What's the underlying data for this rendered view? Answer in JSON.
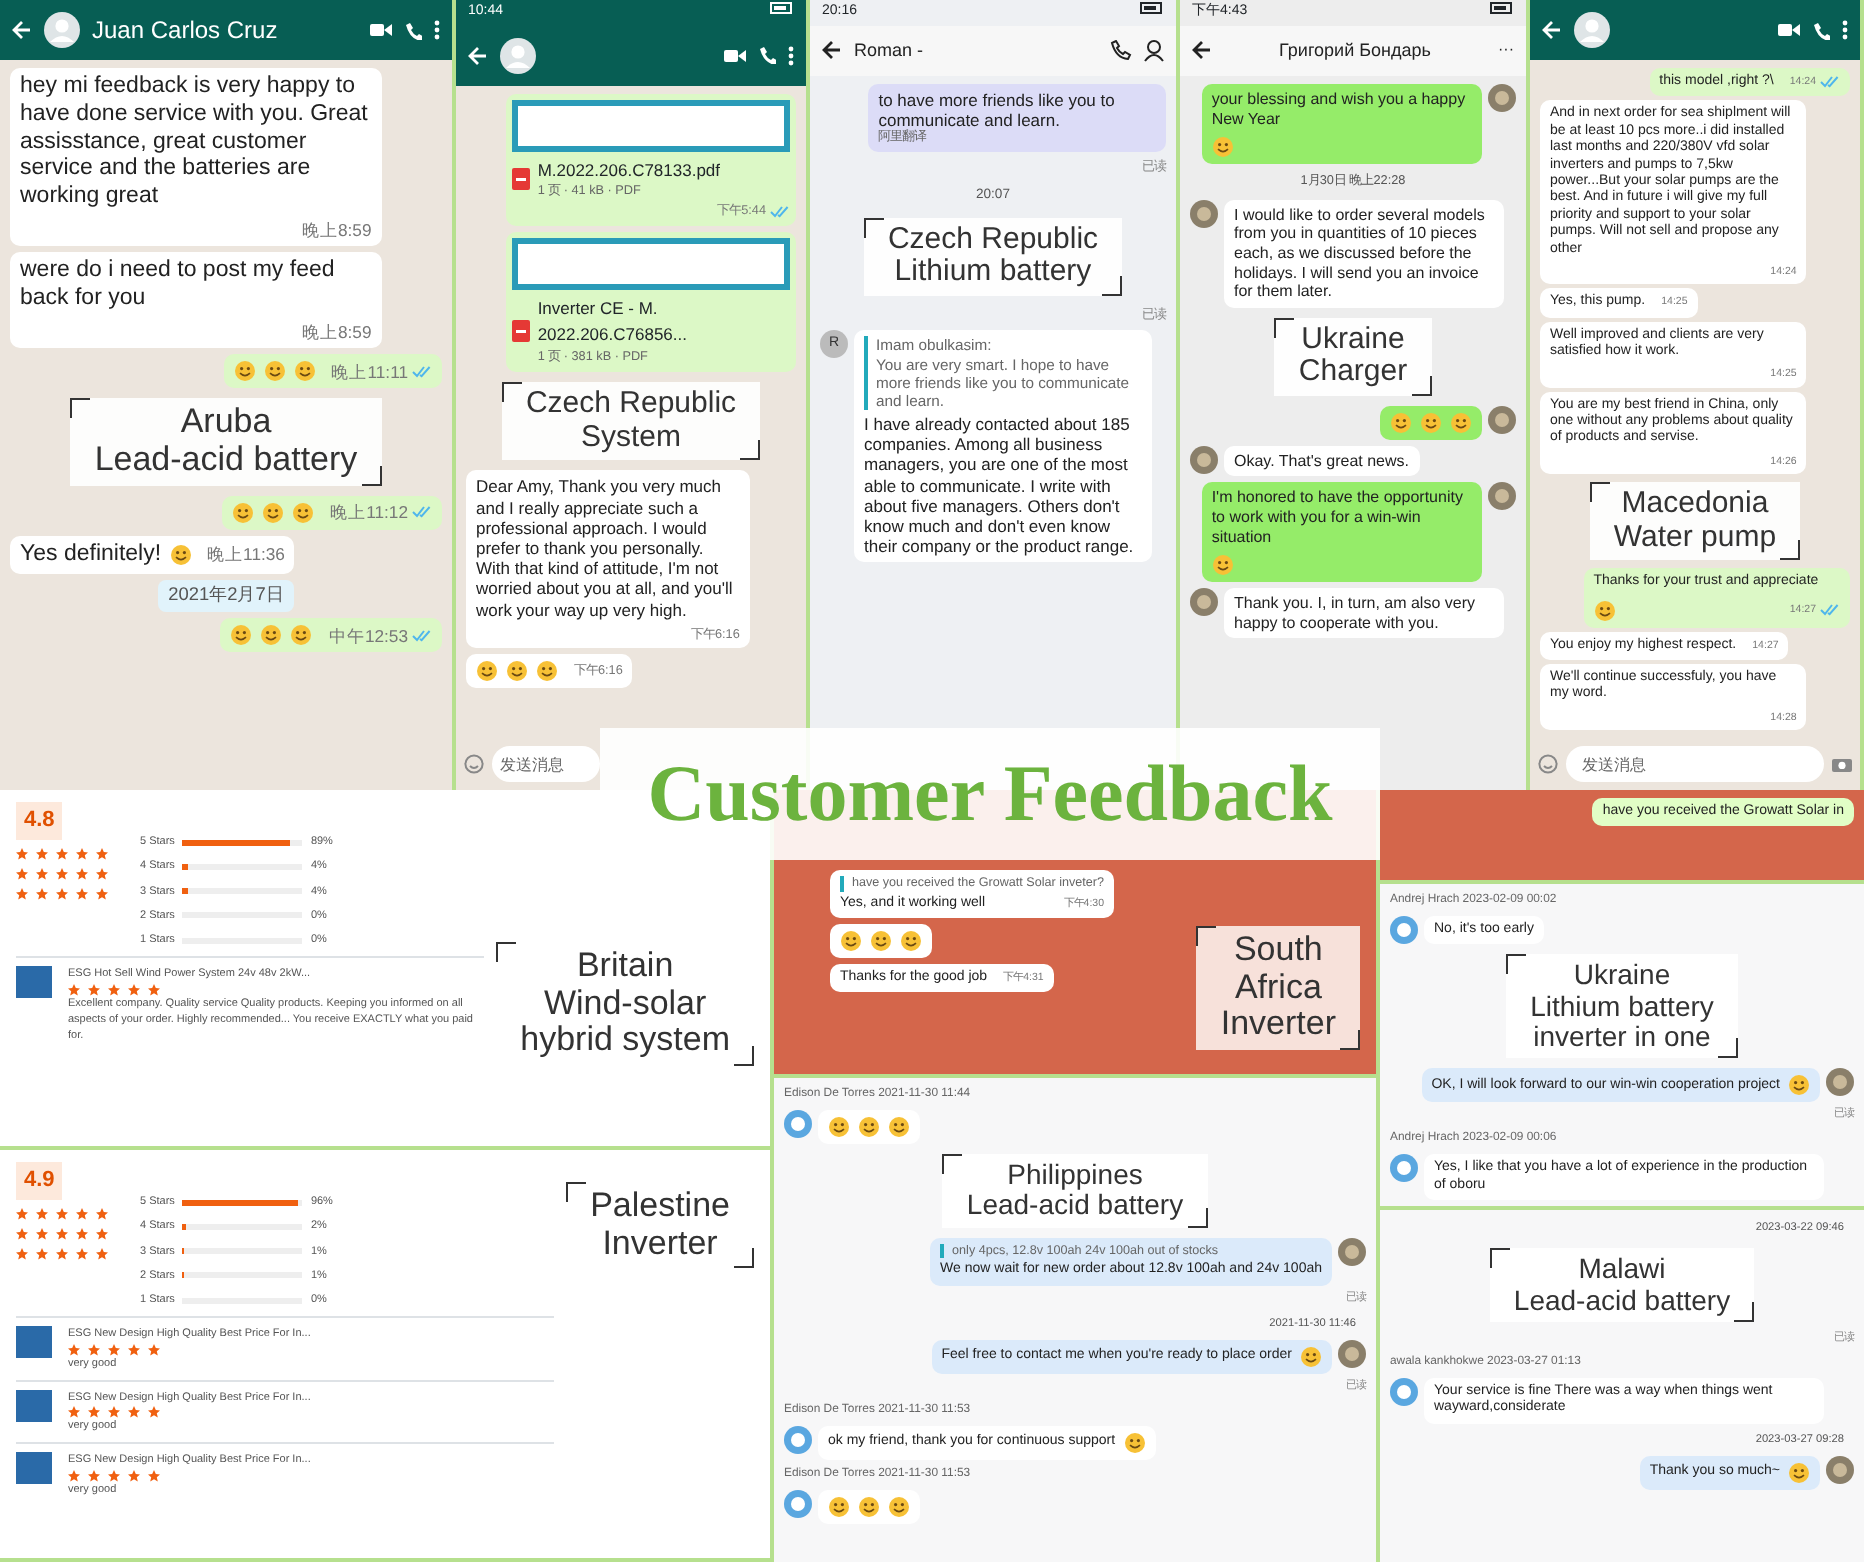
{
  "title": "Customer Feedback",
  "top_panels": [
    {
      "kind": "whatsapp",
      "header": {
        "title": "Juan Carlos Cruz"
      },
      "messages": [
        {
          "kind": "msg",
          "outgoing": false,
          "text": "hey mi feedback is very  happy to have done service  with you. Great assisstance, great customer service and the batteries are working great",
          "time": "晚上8:59"
        },
        {
          "kind": "msg",
          "outgoing": false,
          "text": "were do i need to post my feed back for you",
          "time": "晚上8:59"
        },
        {
          "kind": "msg",
          "outgoing": true,
          "emoji": true,
          "time": "晚上11:11",
          "read": true
        },
        {
          "kind": "label",
          "lines": [
            "Aruba",
            "Lead-acid battery"
          ]
        },
        {
          "kind": "msg",
          "outgoing": true,
          "emoji": true,
          "time": "晚上11:12",
          "read": true
        },
        {
          "kind": "msg",
          "outgoing": false,
          "text": "Yes definitely!",
          "emoji": true,
          "time": "晚上11:36"
        },
        {
          "kind": "date",
          "text": "2021年2月7日"
        },
        {
          "kind": "msg",
          "outgoing": true,
          "emoji": true,
          "time": "中午12:53",
          "read": true
        }
      ]
    },
    {
      "kind": "whatsapp",
      "header": {
        "status_time": "10:44"
      },
      "messages": [
        {
          "kind": "file",
          "name": "M.2022.206.C78133.pdf",
          "meta": "1 页 · 41 kB · PDF",
          "time": "下午5:44",
          "read": true
        },
        {
          "kind": "file",
          "name": "Inverter CE - M. 2022.206.C76856...",
          "meta": "1 页 · 381 kB · PDF"
        },
        {
          "kind": "label",
          "lines": [
            "Czech Republic",
            "System"
          ]
        },
        {
          "kind": "msg",
          "outgoing": false,
          "text": "Dear Amy, Thank you very much and I really appreciate such a professional approach. I would prefer to thank you personally. With that kind of attitude, I'm not worried about you at all, and you'll work your way up very high.",
          "time": "下午6:16"
        },
        {
          "kind": "msg",
          "outgoing": false,
          "emoji": true,
          "time": "下午6:16"
        }
      ],
      "input": {
        "placeholder": "发送消息"
      }
    },
    {
      "kind": "im",
      "header": {
        "status_time": "20:16",
        "title": "Roman -"
      },
      "messages": [
        {
          "kind": "msg",
          "outgoing": true,
          "text": "to have more friends like you to communicate and learn.",
          "note": "阿里翻译"
        },
        {
          "kind": "status",
          "text": "已读"
        },
        {
          "kind": "date",
          "text": "20:07"
        },
        {
          "kind": "label",
          "lines": [
            "Czech Republic",
            "Lithium battery"
          ]
        },
        {
          "kind": "status",
          "text": "已读"
        },
        {
          "kind": "msg",
          "outgoing": false,
          "avatar": "R",
          "quote_name": "Imam obulkasim:",
          "quote": "You are very smart. I hope to have more friends like you to communicate and learn.",
          "text": "I have already contacted about 185 companies. Among all business managers, you are one of the most able to communicate. I write with about five managers. Others don't know much and don't even know their company or the product range."
        }
      ]
    },
    {
      "kind": "wechat",
      "header": {
        "status_time": "下午4:43",
        "title": "Григорий Бондарь",
        "more": "···"
      },
      "messages": [
        {
          "kind": "msg",
          "outgoing": true,
          "text": "your blessing and wish you a happy New Year",
          "emoji": true
        },
        {
          "kind": "date",
          "text": "1月30日 晚上22:28"
        },
        {
          "kind": "msg",
          "outgoing": false,
          "text": "I would like to order several models from you in quantities of 10 pieces each, as we discussed before the holidays. I will send you an invoice for them later."
        },
        {
          "kind": "label",
          "lines": [
            "Ukraine",
            "Charger"
          ]
        },
        {
          "kind": "msg",
          "outgoing": true,
          "emoji": true
        },
        {
          "kind": "msg",
          "outgoing": false,
          "text": "Okay. That's great news."
        },
        {
          "kind": "msg",
          "outgoing": true,
          "text": "I'm honored to have the opportunity to work with you for a win-win situation",
          "emoji": true
        },
        {
          "kind": "msg",
          "outgoing": false,
          "text": "Thank you. I, in turn, am also very happy to cooperate with you."
        }
      ]
    },
    {
      "kind": "whatsapp",
      "messages": [
        {
          "kind": "msg",
          "outgoing": true,
          "text": "this model ,right ?\\",
          "time": "14:24",
          "read": true
        },
        {
          "kind": "msg",
          "outgoing": false,
          "text": "And in next order for sea shiplment will be at least 10 pcs more..i did installed last months and 220/380V vfd solar inverters and pumps to 7,5kw power...But your solar pumps are the best. And in future i will give my full priority and support to your solar pumps. Will not sell and propose any other",
          "time": "14:24"
        },
        {
          "kind": "msg",
          "outgoing": false,
          "text": "Yes, this pump.",
          "time": "14:25"
        },
        {
          "kind": "msg",
          "outgoing": false,
          "text": "Well improved and clients are very satisfied how it work.",
          "time": "14:25"
        },
        {
          "kind": "msg",
          "outgoing": false,
          "text": "You are my best friend in China, only one without any problems about quality of products and servise.",
          "time": "14:26"
        },
        {
          "kind": "label",
          "lines": [
            "Macedonia",
            "Water pump"
          ]
        },
        {
          "kind": "msg",
          "outgoing": true,
          "text": "Thanks for your trust and appreciate",
          "emoji": true,
          "time": "14:27",
          "read": true
        },
        {
          "kind": "msg",
          "outgoing": false,
          "text": "You enjoy my highest respect.",
          "time": "14:27"
        },
        {
          "kind": "msg",
          "outgoing": false,
          "text": "We'll continue successfuly, you have my word.",
          "time": "14:28"
        }
      ],
      "input": {
        "placeholder": "发送消息"
      }
    }
  ],
  "review_panels": [
    {
      "rating": "4.8",
      "star_rows": [
        {
          "stars": 5
        },
        {
          "stars": 5
        },
        {
          "stars": 5
        }
      ],
      "distribution": [
        {
          "label": "5 Stars",
          "level": 0.89,
          "reading": "89%"
        },
        {
          "label": "4 Stars",
          "level": 0.04,
          "reading": "4%"
        },
        {
          "label": "3 Stars",
          "level": 0.04,
          "reading": "4%"
        },
        {
          "label": "2 Stars",
          "level": 0,
          "reading": "0%"
        },
        {
          "label": "1 Stars",
          "level": 0,
          "reading": "0%"
        }
      ],
      "products": [
        {
          "title": "ESG Hot Sell Wind Power System 24v 48v 2kW...",
          "stars": 5,
          "review": "Excellent company. Quality service Quality products. Keeping you informed on all aspects of your order. Highly recommended... You receive EXACTLY what you paid for."
        }
      ],
      "label": [
        "Britain",
        "Wind-solar",
        "hybrid system"
      ]
    },
    {
      "rating": "4.9",
      "star_rows": [
        {
          "stars": 5
        },
        {
          "stars": 5
        },
        {
          "stars": 5
        }
      ],
      "distribution": [
        {
          "label": "5 Stars",
          "level": 0.96,
          "reading": "96%"
        },
        {
          "label": "4 Stars",
          "level": 0.02,
          "reading": "2%"
        },
        {
          "label": "3 Stars",
          "level": 0.01,
          "reading": "1%"
        },
        {
          "label": "2 Stars",
          "level": 0.01,
          "reading": "1%"
        },
        {
          "label": "1 Stars",
          "level": 0,
          "reading": "0%"
        }
      ],
      "products": [
        {
          "title": "ESG New Design High Quality Best Price For In...",
          "stars": 5,
          "review": "very good"
        },
        {
          "title": "ESG New Design High Quality Best Price For In...",
          "stars": 5,
          "review": "very good"
        },
        {
          "title": "ESG New Design High Quality Best Price For In...",
          "stars": 5,
          "review": "very good"
        }
      ],
      "label": [
        "Palestine",
        "Inverter"
      ]
    }
  ],
  "bottom_chats": [
    {
      "kind": "telegram",
      "messages": [
        {
          "kind": "msg",
          "outgoing": false,
          "quote": "have you received the Growatt Solar inveter?",
          "text": "Yes, and it working well",
          "time": "下午4:30"
        },
        {
          "kind": "msg",
          "outgoing": false,
          "emoji": true
        },
        {
          "kind": "msg",
          "outgoing": false,
          "text": "Thanks for the good job",
          "time": "下午4:31"
        }
      ],
      "side_label": [
        "South",
        "Africa",
        "Inverter"
      ]
    },
    {
      "kind": "desk",
      "messages": [
        {
          "kind": "sender",
          "text": "Edison De Torres  2021-11-30 11:44"
        },
        {
          "kind": "msg",
          "outgoing": false,
          "emoji": true
        },
        {
          "kind": "label",
          "lines": [
            "Philippines",
            "Lead-acid battery"
          ]
        },
        {
          "kind": "msg",
          "outgoing": true,
          "quote": "only 4pcs, 12.8v 100ah 24v 100ah out of stocks",
          "text": "We now wait for new order about 12.8v 100ah and 24v 100ah"
        },
        {
          "kind": "status",
          "text": "已读"
        },
        {
          "kind": "date",
          "text": "2021-11-30 11:46"
        },
        {
          "kind": "msg",
          "outgoing": true,
          "text": "Feel free to contact me when you're ready to place order",
          "emoji": true
        },
        {
          "kind": "status",
          "text": "已读"
        },
        {
          "kind": "sender",
          "text": "Edison De Torres  2021-11-30 11:53"
        },
        {
          "kind": "msg",
          "outgoing": false,
          "text": "ok my friend, thank you for continuous support",
          "emoji": true
        },
        {
          "kind": "sender",
          "text": "Edison De Torres  2021-11-30 11:53"
        },
        {
          "kind": "msg",
          "outgoing": false,
          "emoji": true
        }
      ]
    },
    {
      "kind": "telegram",
      "messages": [
        {
          "kind": "msg",
          "outgoing": true,
          "text": "have you received the Growatt Solar in"
        }
      ]
    },
    {
      "kind": "desk",
      "messages": [
        {
          "kind": "sender",
          "text": "Andrej Hrach  2023-02-09 00:02"
        },
        {
          "kind": "msg",
          "outgoing": false,
          "text": "No, it's too early"
        },
        {
          "kind": "label",
          "lines": [
            "Ukraine",
            "Lithium battery",
            "inverter in one"
          ]
        },
        {
          "kind": "msg",
          "outgoing": true,
          "text": "OK, I will look forward to our win-win cooperation project",
          "emoji": true
        },
        {
          "kind": "status",
          "text": "已读"
        },
        {
          "kind": "sender",
          "text": "Andrej Hrach  2023-02-09 00:06"
        },
        {
          "kind": "msg",
          "outgoing": false,
          "text": "Yes, I like that you have a lot of experience in the production of oboru"
        }
      ]
    },
    {
      "kind": "desk",
      "messages": [
        {
          "kind": "date",
          "text": "2023-03-22 09:46"
        },
        {
          "kind": "label",
          "lines": [
            "Malawi",
            "Lead-acid battery"
          ]
        },
        {
          "kind": "status",
          "text": "已读"
        },
        {
          "kind": "sender",
          "text": "awala kankhokwe  2023-03-27 01:13"
        },
        {
          "kind": "msg",
          "outgoing": false,
          "text": "Your service is fine There was a way when things went wayward,considerate"
        },
        {
          "kind": "date",
          "text": "2023-03-27 09:28"
        },
        {
          "kind": "msg",
          "outgoing": true,
          "text": "Thank you so much~",
          "emoji": true
        }
      ]
    }
  ]
}
